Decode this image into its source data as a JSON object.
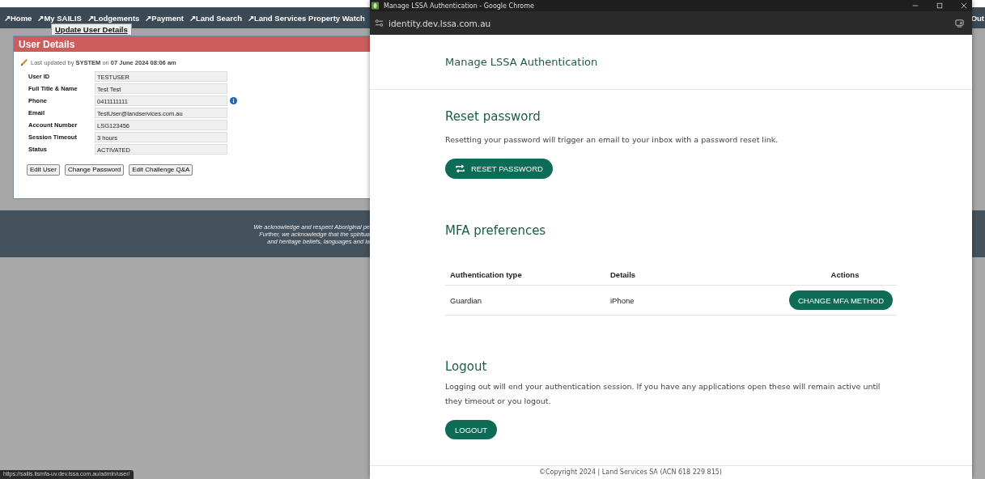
{
  "background_page": {
    "nav": [
      "↗Home",
      "↗My SAILIS",
      "↗Lodgements",
      "↗Payment",
      "↗Land Search",
      "↗Land Services Property Watch"
    ],
    "nav_submenu": "Update User Details",
    "nav_edge": "Out",
    "panel": {
      "title": "User Details",
      "last_updated": "Last updated by **SYSTEM** on **07 June 2024 08:06 am**",
      "fields": [
        {
          "label": "User ID",
          "value": "TESTUSER"
        },
        {
          "label": "Full Title & Name",
          "value": "Test Test"
        },
        {
          "label": "Phone",
          "value": "0411111111",
          "info": true
        },
        {
          "label": "Email",
          "value": "TestUser@landservices.com.au"
        },
        {
          "label": "Account Number",
          "value": "LSG123456"
        },
        {
          "label": "Session Timeout",
          "value": "3 hours"
        },
        {
          "label": "Status",
          "value": "ACTIVATED"
        }
      ],
      "buttons": [
        "Edit User",
        "Change Password",
        "Edit Challenge Q&A"
      ]
    },
    "footer_lines": [
      "We acknowledge and respect Aboriginal pe",
      "Further, we acknowledge that the spiritua",
      "and heritage beliefs, languages and la"
    ],
    "status_url": "https://sailis.lismfa-uv.dev.lssa.com.au/admin/user/"
  },
  "popup": {
    "window_title": "Manage LSSA Authentication - Google Chrome",
    "address": "identity.dev.lssa.com.au",
    "heading": "Manage LSSA Authentication",
    "reset": {
      "title": "Reset password",
      "text": "Resetting your password will trigger an email to your inbox with a password reset link.",
      "button": "RESET PASSWORD"
    },
    "mfa": {
      "title": "MFA preferences",
      "columns": [
        "Authentication type",
        "Details",
        "Actions"
      ],
      "rows": [
        {
          "type": "Guardian",
          "details": "iPhone",
          "action": "CHANGE MFA METHOD"
        }
      ]
    },
    "logout": {
      "title": "Logout",
      "text": "Logging out will end your authentication session. If you have any applications open these will remain active until they timeout or you logout.",
      "button": "LOGOUT"
    },
    "copyright": "©Copyright 2024 | Land Services SA (ACN 618 229 815)"
  }
}
